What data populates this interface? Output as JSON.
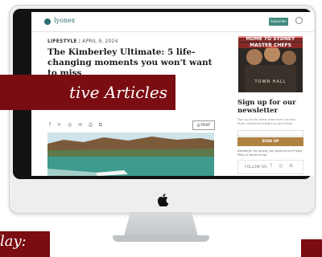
{
  "site": {
    "logo": "lyonex",
    "nav_button": "Subscribe",
    "kicker_category": "LIFESTYLE",
    "kicker_date": "| APRIL 9, 2024",
    "headline": "The Kimberley Ultimate: 5 life-changing moments you won't want to miss",
    "share_icons": "f ✕ ◎ ✉ ⎙ ⧉",
    "print_label": "⎙ PRINT"
  },
  "sidebar": {
    "promo_line1": "HOME TO SYDNEY",
    "promo_line2": "MASTER CHEFS",
    "promo_sub": "TOWN HALL",
    "newsletter_title": "Sign up for our newsletter",
    "newsletter_desc": "Sign up to the latest news from Country Style, delivered straight to your inbox.",
    "signup_label": "SIGN UP",
    "disclaimer": "Disclaimer: By joining, you agree to our Privacy Policy & Terms of Use",
    "follow_label": "FOLLOW US:",
    "follow_icons": "f ◎ ⊕"
  },
  "overlay": {
    "banner_text": "tive Articles",
    "bottom_label": "lay:"
  },
  "colors": {
    "accent_red": "#7a0c12",
    "brand_teal": "#2f6f72",
    "signup_gold": "#b08243"
  }
}
